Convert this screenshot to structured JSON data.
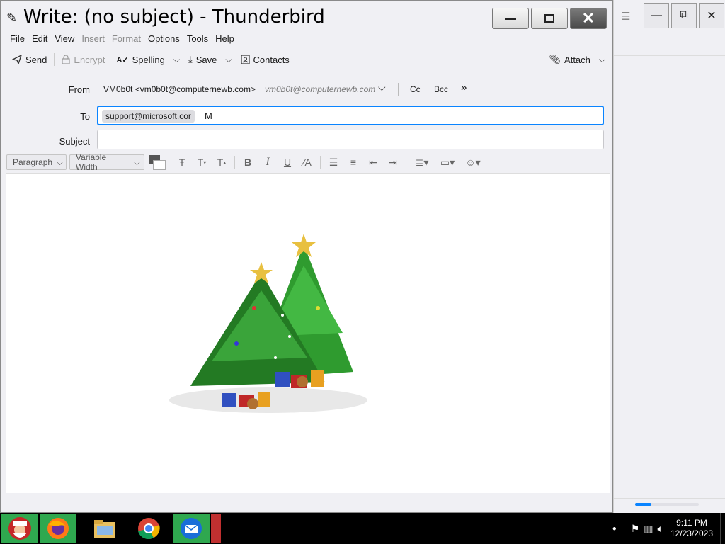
{
  "window": {
    "title": "Write: (no subject) - Thunderbird"
  },
  "menu": [
    "File",
    "Edit",
    "View",
    "Insert",
    "Format",
    "Options",
    "Tools",
    "Help"
  ],
  "menu_disabled": [
    "Insert",
    "Format"
  ],
  "toolbar": {
    "send": "Send",
    "encrypt": "Encrypt",
    "spelling": "Spelling",
    "save": "Save",
    "contacts": "Contacts",
    "attach": "Attach"
  },
  "headers": {
    "from_label": "From",
    "from_value": "VM0b0t <vm0b0t@computernewb.com>",
    "from_identity": "vm0b0t@computernewb.com",
    "cc": "Cc",
    "bcc": "Bcc",
    "to_label": "To",
    "to_recipient": "support@microsoft.cor",
    "to_typed": "M",
    "subject_label": "Subject",
    "subject_value": ""
  },
  "format": {
    "paragraph": "Paragraph",
    "font": "Variable Width"
  },
  "taskbar": {
    "time": "9:11 PM",
    "date": "12/23/2023"
  }
}
